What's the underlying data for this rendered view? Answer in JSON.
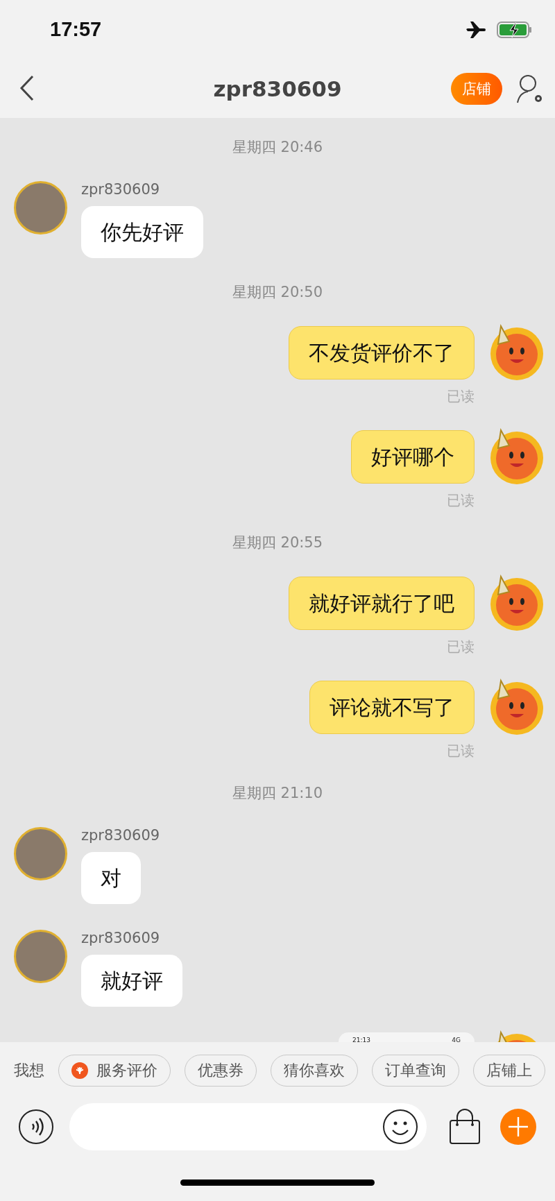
{
  "status_bar": {
    "time": "17:57"
  },
  "header": {
    "title": "zpr830609",
    "shop_button": "店铺"
  },
  "messages": [
    {
      "kind": "time",
      "text": "星期四 20:46"
    },
    {
      "kind": "incoming",
      "name": "zpr830609",
      "text": "你先好评"
    },
    {
      "kind": "time",
      "text": "星期四 20:50"
    },
    {
      "kind": "outgoing",
      "text": "不发货评价不了",
      "status": "已读"
    },
    {
      "kind": "outgoing",
      "text": "好评哪个",
      "status": "已读"
    },
    {
      "kind": "time",
      "text": "星期四 20:55"
    },
    {
      "kind": "outgoing",
      "text": "就好评就行了吧",
      "status": "已读"
    },
    {
      "kind": "outgoing",
      "text": "评论就不写了",
      "status": "已读"
    },
    {
      "kind": "time",
      "text": "星期四 21:10"
    },
    {
      "kind": "incoming",
      "name": "zpr830609",
      "text": "对"
    },
    {
      "kind": "incoming",
      "name": "zpr830609",
      "text": "就好评"
    },
    {
      "kind": "image",
      "time": "21:13",
      "network": "4G"
    }
  ],
  "quick_replies": {
    "label": "我想",
    "chips": [
      {
        "label": "服务评价",
        "kind": "icon"
      },
      {
        "label": "优惠券",
        "kind": "plain"
      },
      {
        "label": "猜你喜欢",
        "kind": "plain"
      },
      {
        "label": "订单查询",
        "kind": "plain"
      },
      {
        "label": "店铺上",
        "kind": "plain"
      }
    ]
  }
}
